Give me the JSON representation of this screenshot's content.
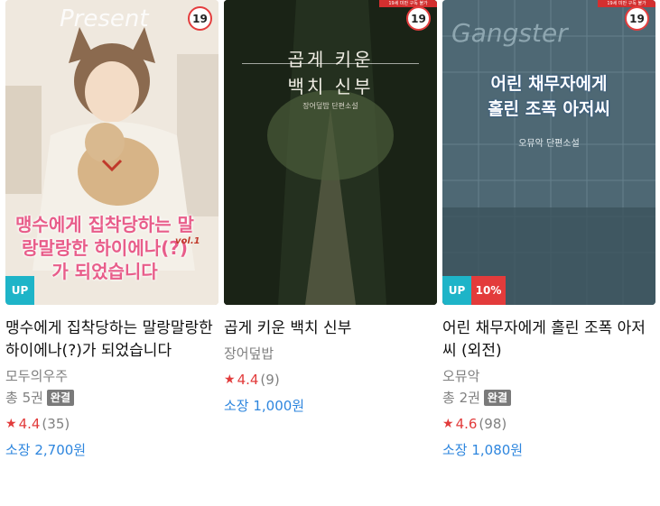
{
  "books": [
    {
      "title": "맹수에게 집착당하는 말랑말랑한 하이에나(?)가 되었습니다",
      "author": "모두의우주",
      "volumes": "총 5권",
      "complete": "완결",
      "age": "19",
      "up": "UP",
      "rating": "4.4",
      "reviews": "(35)",
      "price": "소장 2,700원",
      "cover_title": "맹수에게 집착당하는 말랑말랑한 하이에나(?)가 되었습니다",
      "cover_vol": "vol.1",
      "cover_word": "Present"
    },
    {
      "title": "곱게 키운 백치 신부",
      "author": "장어덮밥",
      "age": "19",
      "age_strip": "19세 미만 구독 불가",
      "rating": "4.4",
      "reviews": "(9)",
      "price": "소장 1,000원",
      "cover_title_1": "곱게 키운",
      "cover_title_2": "백치 신부",
      "cover_sub": "장어덮밥 단편소설"
    },
    {
      "title": "어린 채무자에게 홀린 조폭 아저씨 (외전)",
      "author": "오뮤악",
      "volumes": "총 2권",
      "complete": "완결",
      "age": "19",
      "age_strip": "19세 미만 구독 불가",
      "up": "UP",
      "discount": "10%",
      "rating": "4.6",
      "reviews": "(98)",
      "price": "소장 1,080원",
      "cover_title_1": "어린 채무자에게",
      "cover_title_2": "홀린 조폭 아저씨",
      "cover_sub": "오뮤악 단편소설",
      "cover_word": "Gangster"
    }
  ],
  "icons": {
    "star": "star-icon"
  },
  "colors": {
    "accent_red": "#e23b3b",
    "price_blue": "#2e86de",
    "up_teal": "#1eb4c8"
  }
}
